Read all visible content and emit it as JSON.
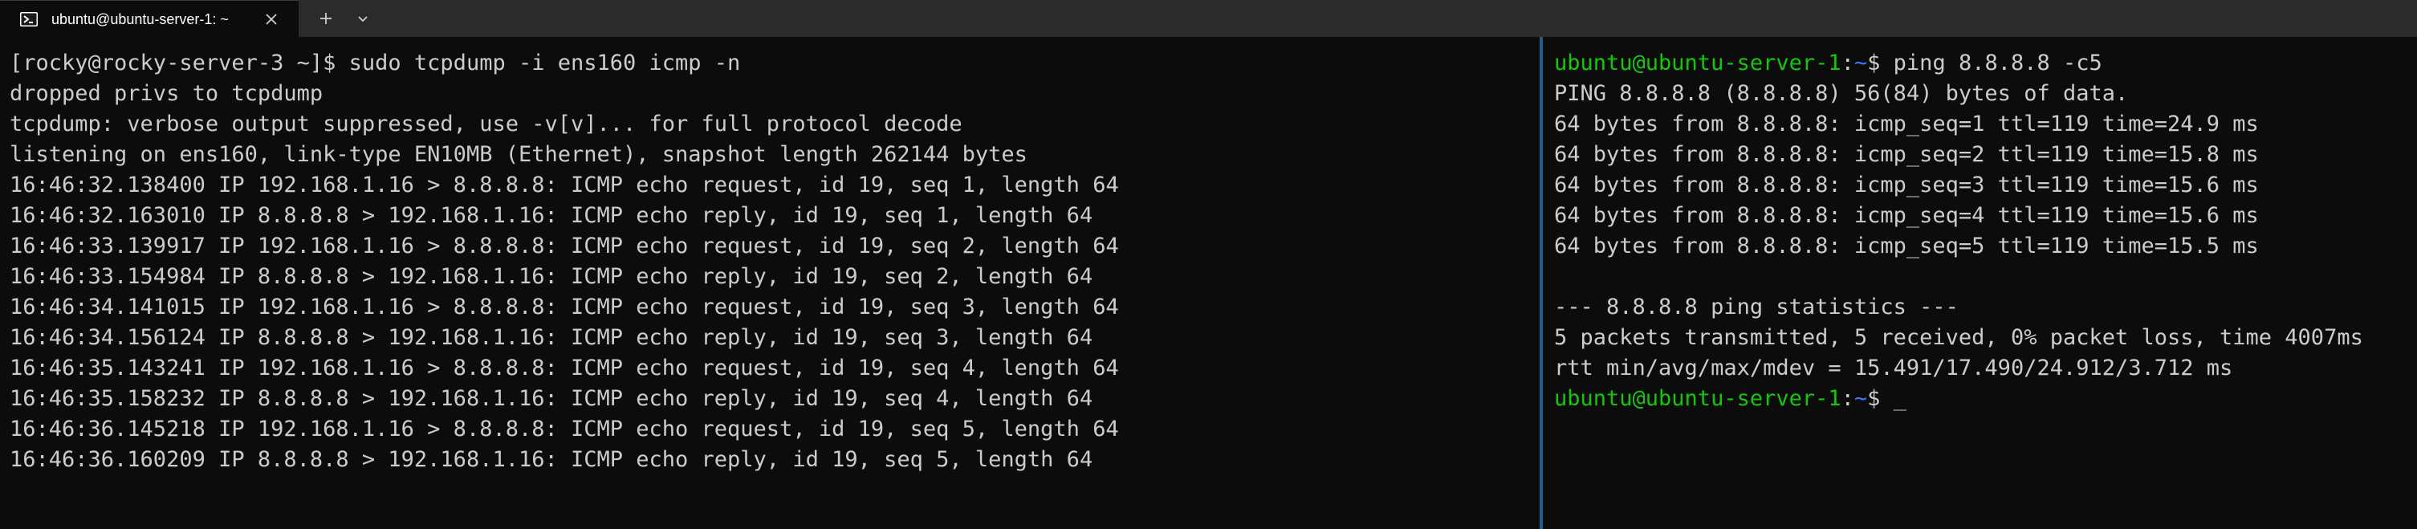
{
  "tabbar": {
    "tab_title": "ubuntu@ubuntu-server-1: ~",
    "tab_icon": "powershell-icon",
    "close_icon": "close-icon",
    "new_tab_icon": "plus-icon",
    "dropdown_icon": "chevron-down-icon"
  },
  "colors": {
    "background": "#0c0c0c",
    "tabbar": "#2b2b2b",
    "text": "#cccccc",
    "prompt_user": "#16c60c",
    "prompt_path": "#3b78ff",
    "divider": "#1f5c94"
  },
  "left_pane": {
    "lines": [
      "[rocky@rocky-server-3 ~]$ sudo tcpdump -i ens160 icmp -n",
      "dropped privs to tcpdump",
      "tcpdump: verbose output suppressed, use -v[v]... for full protocol decode",
      "listening on ens160, link-type EN10MB (Ethernet), snapshot length 262144 bytes",
      "16:46:32.138400 IP 192.168.1.16 > 8.8.8.8: ICMP echo request, id 19, seq 1, length 64",
      "16:46:32.163010 IP 8.8.8.8 > 192.168.1.16: ICMP echo reply, id 19, seq 1, length 64",
      "16:46:33.139917 IP 192.168.1.16 > 8.8.8.8: ICMP echo request, id 19, seq 2, length 64",
      "16:46:33.154984 IP 8.8.8.8 > 192.168.1.16: ICMP echo reply, id 19, seq 2, length 64",
      "16:46:34.141015 IP 192.168.1.16 > 8.8.8.8: ICMP echo request, id 19, seq 3, length 64",
      "16:46:34.156124 IP 8.8.8.8 > 192.168.1.16: ICMP echo reply, id 19, seq 3, length 64",
      "16:46:35.143241 IP 192.168.1.16 > 8.8.8.8: ICMP echo request, id 19, seq 4, length 64",
      "16:46:35.158232 IP 8.8.8.8 > 192.168.1.16: ICMP echo reply, id 19, seq 4, length 64",
      "16:46:36.145218 IP 192.168.1.16 > 8.8.8.8: ICMP echo request, id 19, seq 5, length 64",
      "16:46:36.160209 IP 8.8.8.8 > 192.168.1.16: ICMP echo reply, id 19, seq 5, length 64",
      "",
      "_"
    ]
  },
  "right_pane": {
    "prompt_user": "ubuntu@ubuntu-server-1",
    "prompt_sep": ":",
    "prompt_path": "~",
    "prompt_dollar": "$ ",
    "first_command": "ping 8.8.8.8 -c5",
    "output": [
      "PING 8.8.8.8 (8.8.8.8) 56(84) bytes of data.",
      "64 bytes from 8.8.8.8: icmp_seq=1 ttl=119 time=24.9 ms",
      "64 bytes from 8.8.8.8: icmp_seq=2 ttl=119 time=15.8 ms",
      "64 bytes from 8.8.8.8: icmp_seq=3 ttl=119 time=15.6 ms",
      "64 bytes from 8.8.8.8: icmp_seq=4 ttl=119 time=15.6 ms",
      "64 bytes from 8.8.8.8: icmp_seq=5 ttl=119 time=15.5 ms",
      "",
      "--- 8.8.8.8 ping statistics ---",
      "5 packets transmitted, 5 received, 0% packet loss, time 4007ms",
      "rtt min/avg/max/mdev = 15.491/17.490/24.912/3.712 ms"
    ],
    "cursor": "_"
  }
}
